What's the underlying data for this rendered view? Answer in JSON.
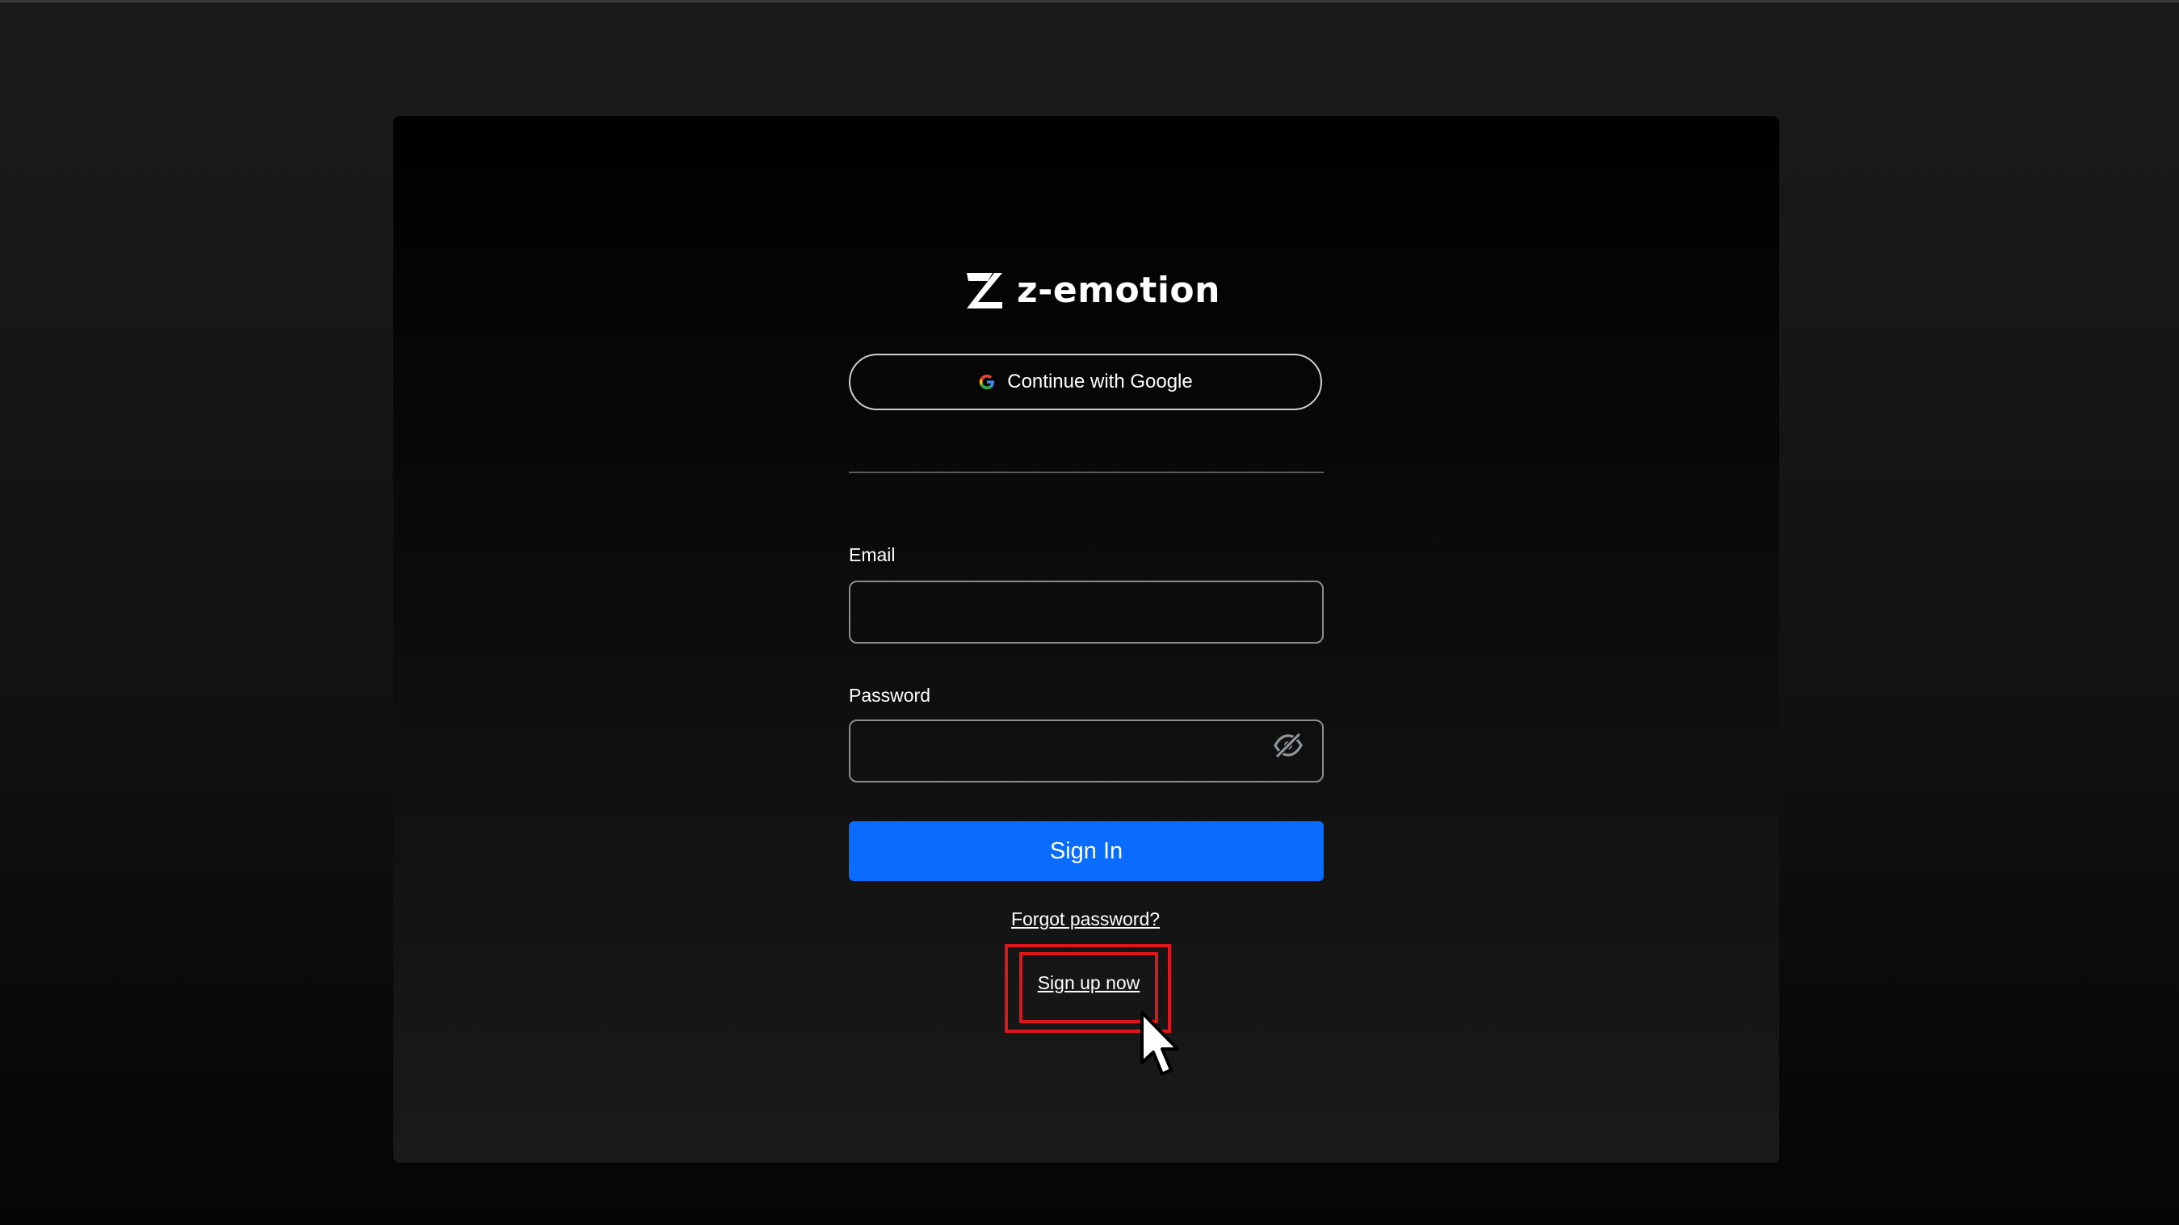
{
  "brand": {
    "name": "z-emotion",
    "logo_icon": "z-logo-icon"
  },
  "auth": {
    "google_button_label": "Continue with Google",
    "google_icon": "google-icon",
    "email_label": "Email",
    "email_value": "",
    "password_label": "Password",
    "password_value": "",
    "password_toggle_icon": "eye-off-icon",
    "sign_in_label": "Sign In",
    "forgot_password_label": "Forgot password?",
    "sign_up_label": "Sign up now"
  },
  "colors": {
    "primary": "#0a6cff",
    "highlight": "#e0151b"
  },
  "overlay": {
    "cursor_icon": "mouse-pointer-icon"
  }
}
